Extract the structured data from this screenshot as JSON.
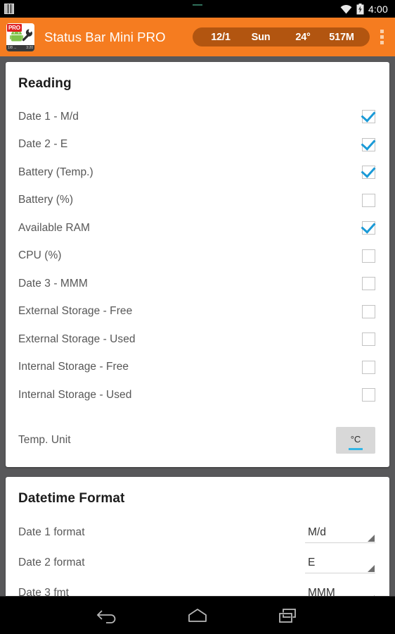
{
  "status_bar": {
    "notification_icon": "sim-card-icon",
    "wifi_icon": "wifi-icon",
    "battery_icon": "battery-charging-icon",
    "clock": "4:00"
  },
  "app_bar": {
    "icon": "app-logo-icon",
    "icon_badge": "PRO",
    "icon_footer_left": "1/8 ...",
    "icon_footer_right": "3:20",
    "title": "Status Bar Mini PRO",
    "preview": [
      "12/1",
      "Sun",
      "24°",
      "517M"
    ],
    "overflow_icon": "overflow-menu-icon",
    "accent_color": "#f57c20",
    "preview_pill_color": "#b25510"
  },
  "reading_card": {
    "title": "Reading",
    "items": [
      {
        "label": "Date 1 - M/d",
        "checked": true
      },
      {
        "label": "Date 2 - E",
        "checked": true
      },
      {
        "label": "Battery (Temp.)",
        "checked": true
      },
      {
        "label": "Battery (%)",
        "checked": false
      },
      {
        "label": "Available RAM",
        "checked": true
      },
      {
        "label": "CPU (%)",
        "checked": false
      },
      {
        "label": "Date 3 - MMM",
        "checked": false
      },
      {
        "label": "External Storage - Free",
        "checked": false
      },
      {
        "label": "External Storage - Used",
        "checked": false
      },
      {
        "label": "Internal Storage - Free",
        "checked": false
      },
      {
        "label": "Internal Storage - Used",
        "checked": false
      }
    ],
    "temp_unit": {
      "label": "Temp. Unit",
      "value": "°C",
      "underline_color": "#33b5e5"
    },
    "checkbox_checked_color": "#1a9ad7"
  },
  "datetime_card": {
    "title": "Datetime Format",
    "rows": [
      {
        "label": "Date 1 format",
        "value": "M/d"
      },
      {
        "label": "Date 2 format",
        "value": "E"
      },
      {
        "label": "Date 3 fmt",
        "value": "MMM"
      }
    ]
  },
  "nav_bar": {
    "back": "back-icon",
    "home": "home-icon",
    "recents": "recents-icon"
  }
}
